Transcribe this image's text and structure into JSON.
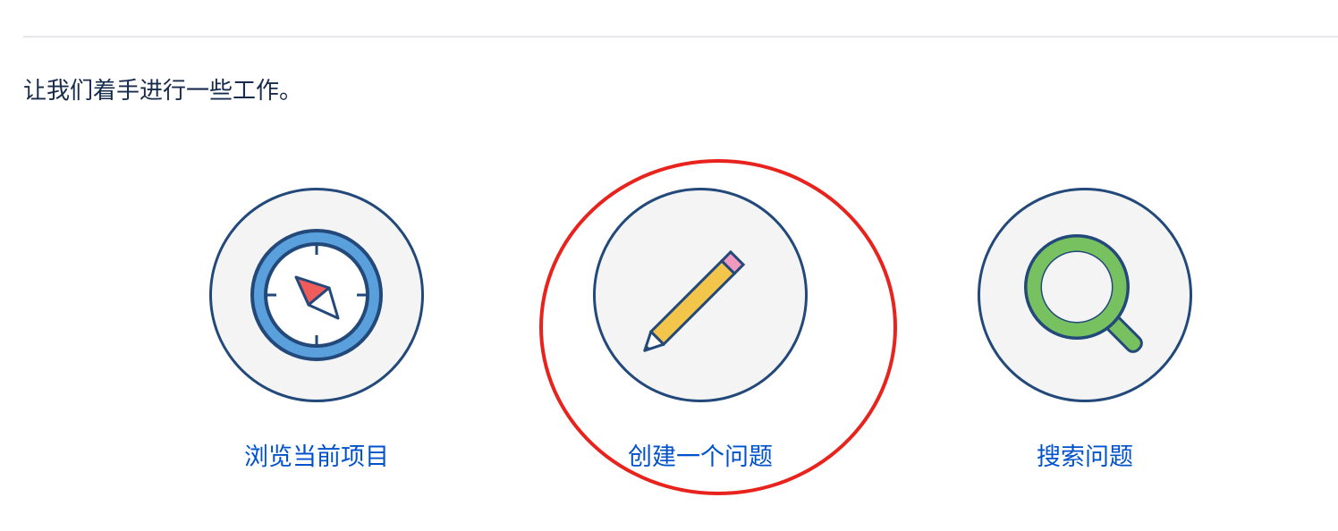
{
  "intro": {
    "text": "让我们着手进行一些工作。"
  },
  "actions": [
    {
      "id": "browse",
      "label": "浏览当前项目",
      "icon": "compass-icon"
    },
    {
      "id": "create",
      "label": "创建一个问题",
      "icon": "pencil-icon"
    },
    {
      "id": "search",
      "label": "搜索问题",
      "icon": "magnifier-icon"
    }
  ],
  "colors": {
    "label": "#0052cc",
    "circle_border": "#22497a",
    "circle_fill": "#f4f4f4",
    "highlight": "#e8231d",
    "text": "#172b4d"
  }
}
